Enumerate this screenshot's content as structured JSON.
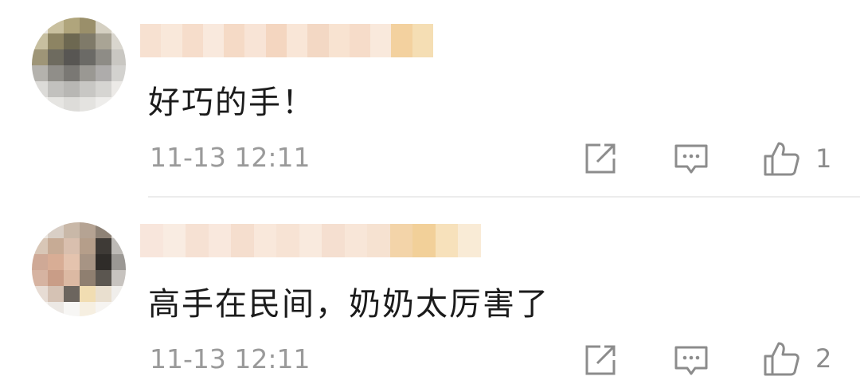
{
  "comments": [
    {
      "text": "好巧的手！",
      "time": "11-13 12:11",
      "likes": "1"
    },
    {
      "text": "高手在民间，奶奶太厉害了",
      "time": "11-13 12:11",
      "likes": "2"
    }
  ],
  "icons": {
    "share": "share-icon",
    "reply": "comment-icon",
    "like": "thumbs-up-icon"
  },
  "colors": {
    "text": "#1b1b1b",
    "meta": "#9a9a9a",
    "icon": "#8c8c8c",
    "divider": "#ececec"
  }
}
